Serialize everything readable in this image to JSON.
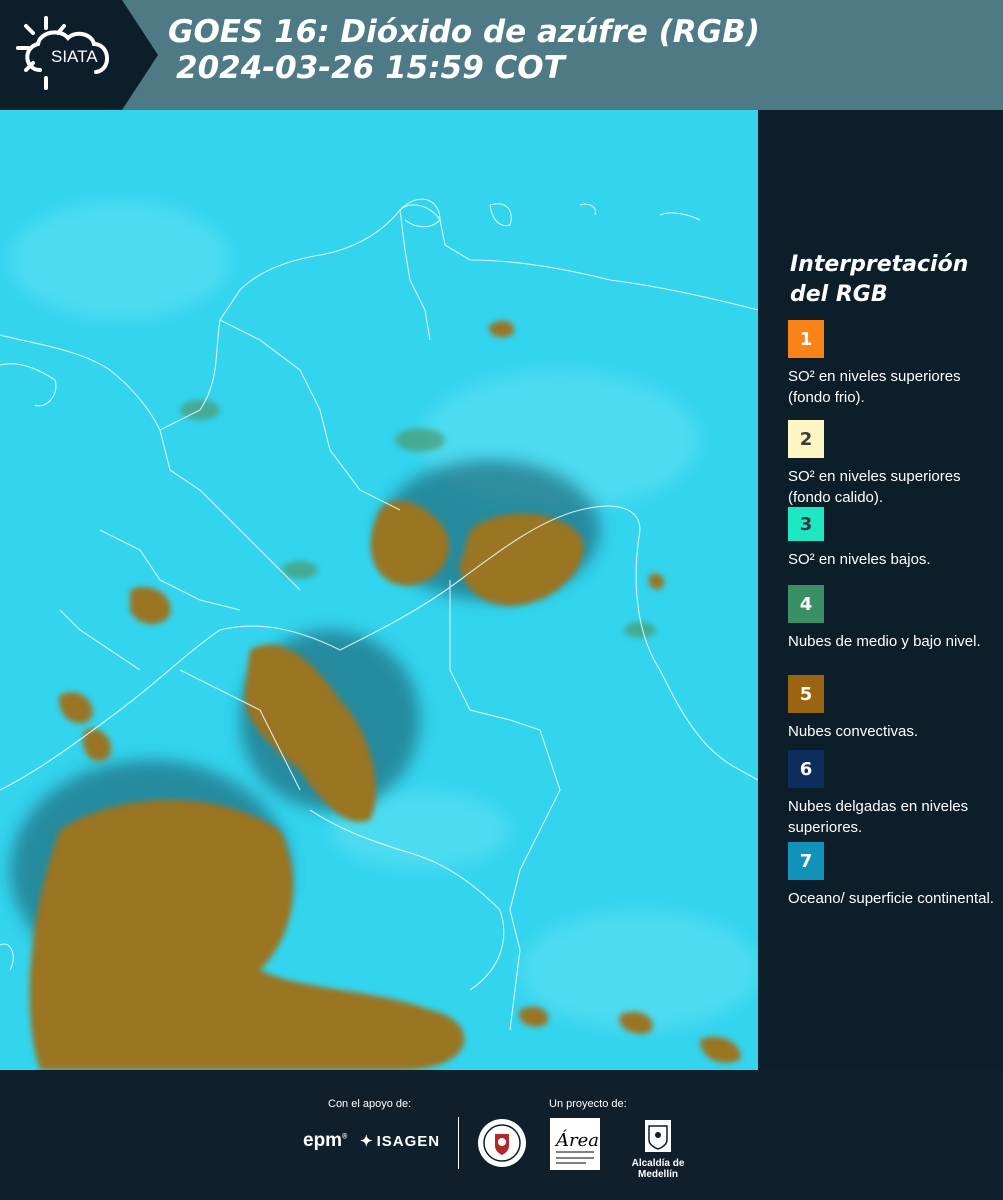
{
  "header": {
    "logo_text": "SIATA",
    "title_line1": "GOES 16: Dióxido de azúfre (RGB)",
    "title_line2": "2024-03-26 15:59 COT"
  },
  "legend": {
    "title": "Interpretación del RGB",
    "items": [
      {
        "number": "1",
        "color": "#f98317",
        "label": "SO² en niveles superiores (fondo frio)."
      },
      {
        "number": "2",
        "color": "#fdf6c3",
        "label": "SO² en niveles superiores (fondo calido)."
      },
      {
        "number": "3",
        "color": "#1fe7c4",
        "label": "SO² en niveles bajos."
      },
      {
        "number": "4",
        "color": "#3a8f64",
        "label": "Nubes de medio y bajo nivel."
      },
      {
        "number": "5",
        "color": "#9a6410",
        "label": "Nubes convectivas."
      },
      {
        "number": "6",
        "color": "#0c2d5e",
        "label": "Nubes delgadas en niveles superiores."
      },
      {
        "number": "7",
        "color": "#1192b8",
        "label": "Oceano/ superficie continental."
      }
    ]
  },
  "map": {
    "background_color": "#33d4ee",
    "cloud_color": "#9a7424"
  },
  "footer": {
    "support_label": "Con el apoyo de:",
    "project_label": "Un proyecto de:",
    "epm": "epm",
    "isagen": "ISAGEN",
    "area_logo_text": "Área",
    "alcaldia": "Alcaldía de Medellín"
  }
}
